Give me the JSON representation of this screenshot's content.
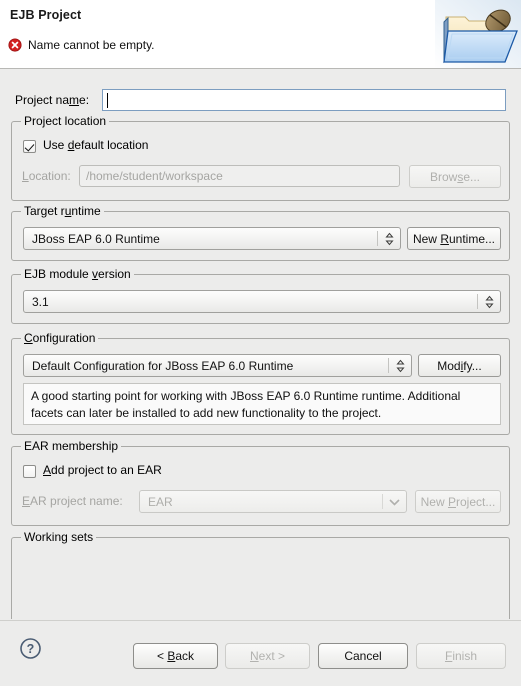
{
  "header": {
    "title": "EJB Project",
    "message": "Name cannot be empty.",
    "error_icon": "error-circle-icon",
    "banner_icon": "ejb-project-folder-icon",
    "error_color": "#d32020"
  },
  "form": {
    "project_name": {
      "label_pre": "Project na",
      "label_mnemonic": "m",
      "label_post": "e:",
      "value": "",
      "placeholder": ""
    },
    "project_location": {
      "group_title": "Project location",
      "use_default": {
        "label_pre": "Use ",
        "label_mnemonic": "d",
        "label_post": "efault location",
        "checked": true
      },
      "location": {
        "label_mnemonic": "L",
        "label_post": "ocation:",
        "value": "/home/student/workspace",
        "enabled": false
      },
      "browse_button": {
        "label_pre": "Brow",
        "label_mnemonic": "s",
        "label_post": "e...",
        "enabled": false
      }
    },
    "target_runtime": {
      "group_title_pre": "Target r",
      "group_title_mnemonic": "u",
      "group_title_post": "ntime",
      "selected": "JBoss EAP 6.0 Runtime",
      "new_runtime_button": {
        "label_pre": "New ",
        "label_mnemonic": "R",
        "label_post": "untime..."
      }
    },
    "ejb_module_version": {
      "group_title_pre": "EJB module ",
      "group_title_mnemonic": "v",
      "group_title_post": "ersion",
      "selected": "3.1"
    },
    "configuration": {
      "group_title_mnemonic": "C",
      "group_title_post": "onfiguration",
      "selected": "Default Configuration for JBoss EAP 6.0 Runtime",
      "modify_button": {
        "label_pre": "Mod",
        "label_mnemonic": "i",
        "label_post": "fy..."
      },
      "description": "A good starting point for working with JBoss EAP 6.0 Runtime runtime. Additional facets can later be installed to add new functionality to the project."
    },
    "ear_membership": {
      "group_title": "EAR membership",
      "add_to_ear": {
        "label_mnemonic": "A",
        "label_post": "dd project to an EAR",
        "checked": false
      },
      "ear_project_name": {
        "label_mnemonic": "E",
        "label_post": "AR project name:",
        "value": "EAR",
        "enabled": false
      },
      "new_project_button": {
        "label_pre": "New ",
        "label_mnemonic": "P",
        "label_post": "roject...",
        "enabled": false
      }
    },
    "working_sets": {
      "group_title": "Working sets"
    }
  },
  "footer": {
    "help_icon": "help-question-icon",
    "back_button": {
      "label_pre": "< ",
      "label_mnemonic": "B",
      "label_post": "ack",
      "enabled": true
    },
    "next_button": {
      "label_mnemonic": "N",
      "label_post": "ext >",
      "enabled": false
    },
    "cancel_button": {
      "label": "Cancel",
      "enabled": true
    },
    "finish_button": {
      "label_mnemonic": "F",
      "label_post": "inish",
      "enabled": false
    }
  }
}
